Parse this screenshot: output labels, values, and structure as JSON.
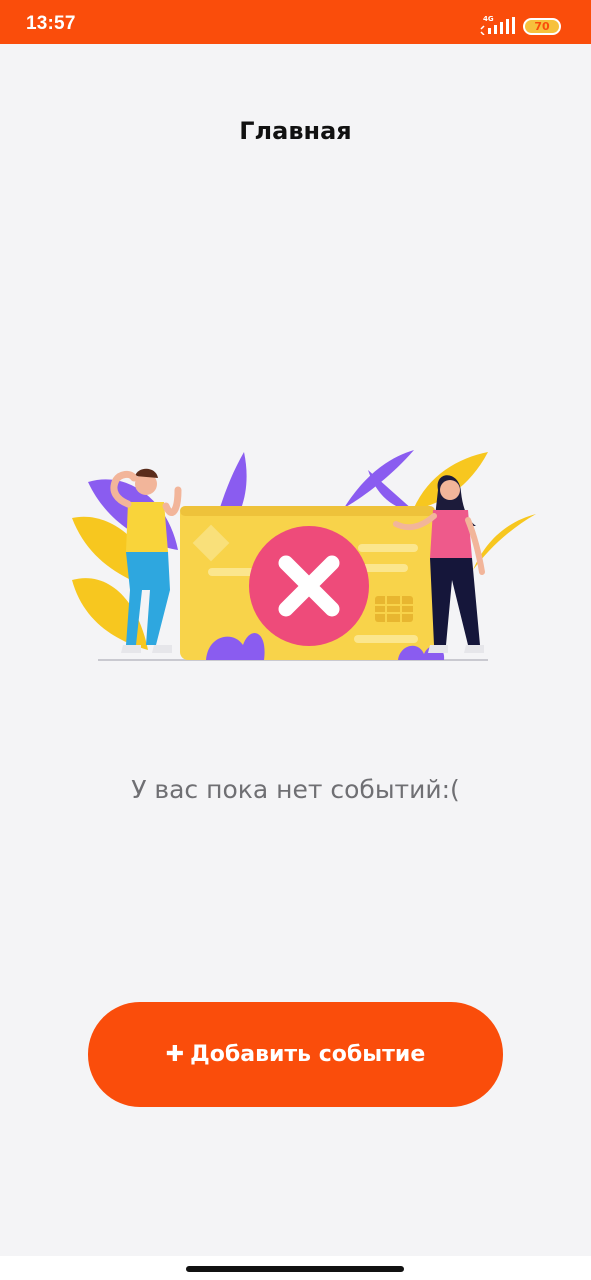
{
  "status_bar": {
    "time": "13:57",
    "network": "4G",
    "battery": "70",
    "background_color": "#fa4d0b"
  },
  "header": {
    "title": "Главная"
  },
  "main": {
    "illustration": "empty-events-illustration",
    "empty_message": "У вас пока нет событий:("
  },
  "actions": {
    "add_event_label": "Добавить событие",
    "add_event_icon": "plus-icon",
    "button_color": "#fa4d0b"
  }
}
